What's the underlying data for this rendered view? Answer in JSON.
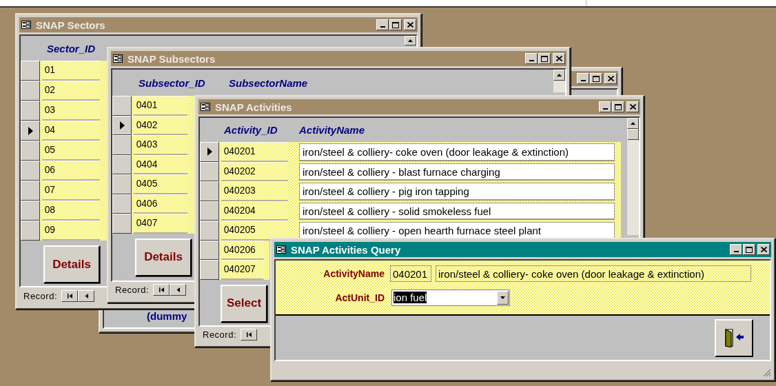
{
  "background_window": {
    "active": false,
    "footer_text": "(dummy"
  },
  "sectors_window": {
    "title": "SNAP Sectors",
    "active": false,
    "columns": [
      "Sector_ID"
    ],
    "rows": [
      {
        "code": "01",
        "selected": false
      },
      {
        "code": "02",
        "selected": false
      },
      {
        "code": "03",
        "selected": false
      },
      {
        "code": "04",
        "selected": true
      },
      {
        "code": "05",
        "selected": false
      },
      {
        "code": "06",
        "selected": false
      },
      {
        "code": "07",
        "selected": false
      },
      {
        "code": "08",
        "selected": false
      },
      {
        "code": "09",
        "selected": false
      }
    ],
    "button": "Details",
    "record_label": "Record:",
    "nav": [
      {
        "kind": "first"
      },
      {
        "kind": "previous"
      }
    ]
  },
  "subsectors_window": {
    "title": "SNAP Subsectors",
    "active": false,
    "columns": [
      "Subsector_ID",
      "SubsectorName"
    ],
    "rows": [
      {
        "code": "0401",
        "selected": false
      },
      {
        "code": "0402",
        "selected": true
      },
      {
        "code": "0403",
        "selected": false
      },
      {
        "code": "0404",
        "selected": false
      },
      {
        "code": "0405",
        "selected": false
      },
      {
        "code": "0406",
        "selected": false
      },
      {
        "code": "0407",
        "selected": false
      }
    ],
    "button": "Details",
    "record_label": "Record:",
    "nav": [
      {
        "kind": "first"
      },
      {
        "kind": "previous"
      }
    ]
  },
  "activities_window": {
    "title": "SNAP Activities",
    "active": false,
    "columns": [
      "Activity_ID",
      "ActivityName"
    ],
    "rows": [
      {
        "code": "040201",
        "name": "iron/steel & colliery- coke oven (door leakage & extinction)",
        "selected": true
      },
      {
        "code": "040202",
        "name": "iron/steel & colliery - blast furnace charging",
        "selected": false
      },
      {
        "code": "040203",
        "name": "iron/steel & colliery - pig iron tapping",
        "selected": false
      },
      {
        "code": "040204",
        "name": "iron/steel & colliery - solid smokeless fuel",
        "selected": false
      },
      {
        "code": "040205",
        "name": "iron/steel & colliery - open hearth furnace steel plant",
        "selected": false
      },
      {
        "code": "040206",
        "selected": false
      },
      {
        "code": "040207",
        "selected": false
      }
    ],
    "button": "Select",
    "record_label": "Record:",
    "nav": [
      {
        "kind": "first"
      }
    ]
  },
  "query_window": {
    "title": "SNAP Activities Query",
    "active": true,
    "activity_name": {
      "label": "ActivityName",
      "code": "040201",
      "name": "iron/steel & colliery- coke oven (door leakage & extinction)"
    },
    "act_unit": {
      "label": "ActUnit_ID",
      "value": "ion fuel",
      "highlighted": true
    }
  }
}
